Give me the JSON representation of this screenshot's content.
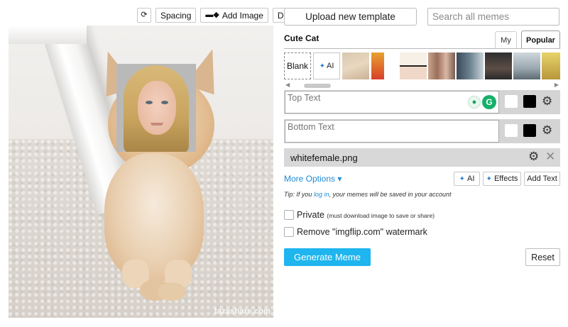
{
  "toolbar": {
    "rotate_icon": "rotate-icon",
    "spacing_label": "Spacing",
    "add_image_icon": "add-image-icon",
    "add_image_label": "Add Image",
    "draw_label": "Draw"
  },
  "canvas": {
    "face_image": "woman-face-photo",
    "background_image": "cat-photo",
    "watermark": "tazashare.com"
  },
  "header": {
    "upload_label": "Upload new template",
    "search_placeholder": "Search all memes"
  },
  "template": {
    "name": "Cute Cat"
  },
  "tabs": [
    {
      "label": "My",
      "active": false
    },
    {
      "label": "Popular",
      "active": true
    }
  ],
  "thumbnails": {
    "blank_label": "Blank",
    "ai_label": "AI",
    "ai_icon": "sparkle-icon",
    "items": [
      "cat",
      "red-portrait",
      "two-panel-comic",
      "crowd-photo",
      "woman-yelling",
      "man-desk",
      "man-portrait",
      "green-comic",
      "yellow-creature"
    ]
  },
  "text_boxes": [
    {
      "placeholder": "Top Text",
      "value": "",
      "color_fill": "#ffffff",
      "color_outline": "#000000"
    },
    {
      "placeholder": "Bottom Text",
      "value": "",
      "color_fill": "#ffffff",
      "color_outline": "#000000"
    }
  ],
  "extensions": {
    "bulb_icon": "lightbulb-icon",
    "grammarly_label": "G"
  },
  "image_layer": {
    "filename": "whitefemale.png"
  },
  "options": {
    "more_label": "More Options ▾",
    "ai_label": "AI",
    "effects_label": "Effects",
    "add_text_label": "Add Text"
  },
  "tip": {
    "prefix": "Tip: If you ",
    "link": "log in",
    "suffix": ", your memes will be saved in your account"
  },
  "checkboxes": {
    "private_label": "Private",
    "private_note": "(must download image to save or share)",
    "private_checked": false,
    "watermark_label": "Remove \"imgflip.com\" watermark",
    "watermark_checked": false
  },
  "actions": {
    "generate_label": "Generate Meme",
    "reset_label": "Reset"
  },
  "colors": {
    "accent": "#1fb5ee",
    "link": "#1f8bd6"
  }
}
